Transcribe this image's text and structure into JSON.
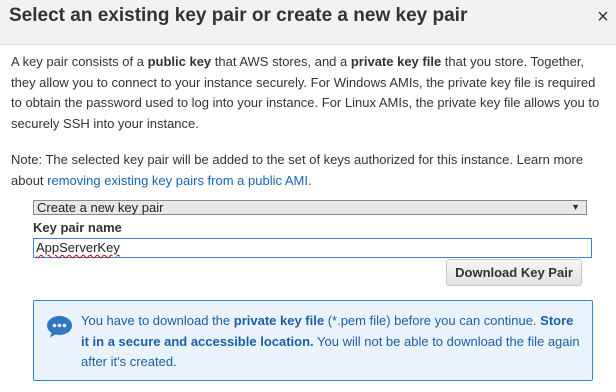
{
  "dialog": {
    "title": "Select an existing key pair or create a new key pair",
    "close_symbol": "×"
  },
  "intro": {
    "t1": "A key pair consists of a ",
    "b1": "public key",
    "t2": " that AWS stores, and a ",
    "b2": "private key file",
    "t3": " that you store. Together, they allow you to connect to your instance securely. For Windows AMIs, the private key file is required to obtain the password used to log into your instance. For Linux AMIs, the private key file allows you to securely SSH into your instance."
  },
  "note": {
    "text": "Note: The selected key pair will be added to the set of keys authorized for this instance. Learn more about ",
    "link": "removing existing key pairs from a public AMI",
    "end": "."
  },
  "form": {
    "select_value": "Create a new key pair",
    "select_arrow_icon": "dropdown-triangle",
    "key_pair_label": "Key pair name",
    "key_pair_value": "AppServerKey",
    "download_button": "Download Key Pair"
  },
  "notice": {
    "icon": "chat-bubble-ellipsis",
    "t1": "You have to download the ",
    "b1": "private key file",
    "t2": " (*.pem file) before you can continue. ",
    "b2": "Store it in a secure and accessible location.",
    "t3": " You will not be able to download the file again after it's created."
  },
  "colors": {
    "link": "#1166bb",
    "notice_border": "#2e8bd8",
    "notice_bg": "#eaf3fb",
    "notice_text": "#1a5fa8",
    "input_focus_border": "#3b82d6"
  }
}
